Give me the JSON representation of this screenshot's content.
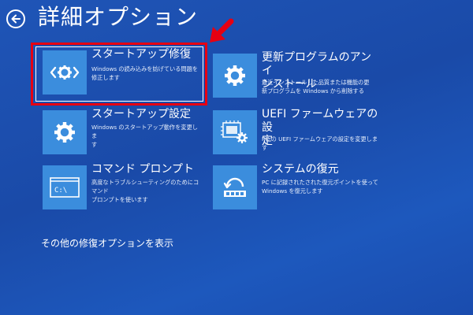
{
  "header": {
    "title": "詳細オプション"
  },
  "tiles": [
    {
      "title": "スタートアップ修復",
      "desc_lines": [
        "Windows の読み込みを妨げている問題を",
        "修正します"
      ]
    },
    {
      "title": "スタートアップ設定",
      "desc_lines": [
        "Windows のスタートアップ動作を変更しま",
        "す"
      ]
    },
    {
      "title": "コマンド プロンプト",
      "desc_lines": [
        "高度なトラブルシューティングのためにコマンド",
        "プロンプトを使います"
      ]
    },
    {
      "title_lines": [
        "更新プログラムのアンイ",
        "ンストール"
      ],
      "desc_lines": [
        "最近インストールした品質または機能の更",
        "新プログラムを Windows から削除する"
      ]
    },
    {
      "title_lines": [
        "UEFI ファームウェアの設",
        "定"
      ],
      "desc_lines": [
        "PC の UEFI ファームウェアの設定を変更します"
      ]
    },
    {
      "title": "システムの復元",
      "desc_lines": [
        "PC に記録されたされた復元ポイントを使って",
        "Windows を復元します"
      ]
    }
  ],
  "footer": {
    "more_options": "その他の修復オプションを表示"
  },
  "colors": {
    "background": "#1a4aa8",
    "tile_icon_bg": "#3b8ddd",
    "highlight": "#e60012"
  },
  "icons": [
    "back-arrow-icon",
    "code-gear-icon",
    "gear-icon",
    "firmware-chip-icon",
    "command-prompt-icon",
    "system-restore-icon",
    "pointer-arrow-icon"
  ]
}
